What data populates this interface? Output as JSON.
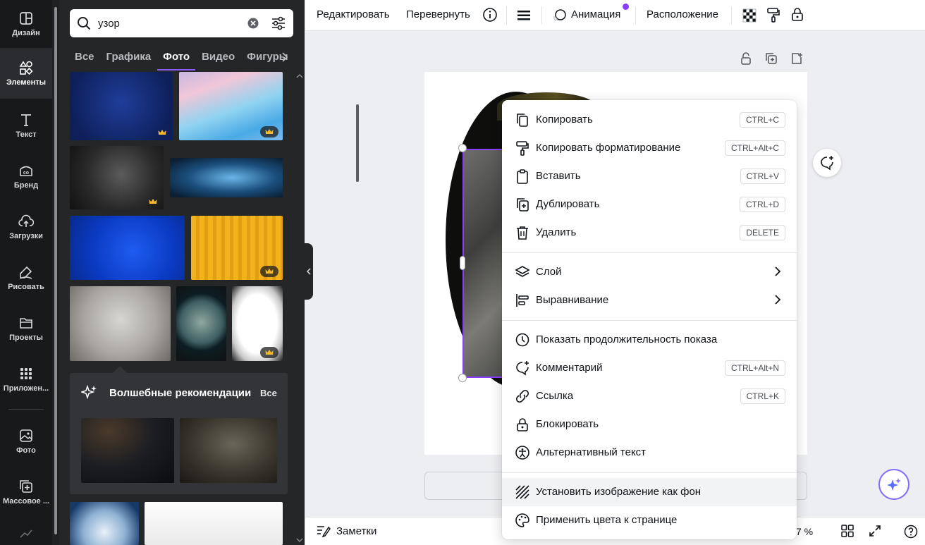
{
  "rail": {
    "items": [
      {
        "label": "Дизайн",
        "icon": "layout-icon"
      },
      {
        "label": "Элементы",
        "icon": "shapes-icon"
      },
      {
        "label": "Текст",
        "icon": "text-icon"
      },
      {
        "label": "Бренд",
        "icon": "brand-icon"
      },
      {
        "label": "Загрузки",
        "icon": "cloud-upload-icon"
      },
      {
        "label": "Рисовать",
        "icon": "draw-icon"
      },
      {
        "label": "Проекты",
        "icon": "folder-icon"
      },
      {
        "label": "Приложен...",
        "icon": "apps-grid-icon"
      },
      {
        "label": "Фото",
        "icon": "photo-icon"
      },
      {
        "label": "Массовое ...",
        "icon": "bulk-create-icon"
      }
    ],
    "active_index": 1
  },
  "search": {
    "value": "узор"
  },
  "tabs": [
    "Все",
    "Графика",
    "Фото",
    "Видео",
    "Фигуры"
  ],
  "active_tab": "Фото",
  "magic": {
    "title": "Волшебные рекомендации",
    "all_label": "Все"
  },
  "toolbar": {
    "edit": "Редактировать",
    "flip": "Перевернуть",
    "animation": "Анимация",
    "position": "Расположение"
  },
  "context_menu": {
    "copy": {
      "label": "Копировать",
      "shortcut": "CTRL+C"
    },
    "copy_style": {
      "label": "Копировать форматирование",
      "shortcut": "CTRL+Alt+C"
    },
    "paste": {
      "label": "Вставить",
      "shortcut": "CTRL+V"
    },
    "duplicate": {
      "label": "Дублировать",
      "shortcut": "CTRL+D"
    },
    "delete": {
      "label": "Удалить",
      "shortcut": "DELETE"
    },
    "layer": {
      "label": "Слой"
    },
    "align": {
      "label": "Выравнивание"
    },
    "show_timing": {
      "label": "Показать продолжительность показа"
    },
    "comment": {
      "label": "Комментарий",
      "shortcut": "CTRL+Alt+N"
    },
    "link": {
      "label": "Ссылка",
      "shortcut": "CTRL+K"
    },
    "lock": {
      "label": "Блокировать"
    },
    "alt_text": {
      "label": "Альтернативный текст"
    },
    "set_background": {
      "label": "Установить изображение как фон"
    },
    "apply_colors": {
      "label": "Применить цвета к странице"
    }
  },
  "bottombar": {
    "notes": "Заметки",
    "zoom": "7 %"
  },
  "colors": {
    "accent": "#8b3dff",
    "panel_bg": "#252627",
    "rail_bg": "#18191b",
    "notification_dot": "#8b3dff"
  }
}
